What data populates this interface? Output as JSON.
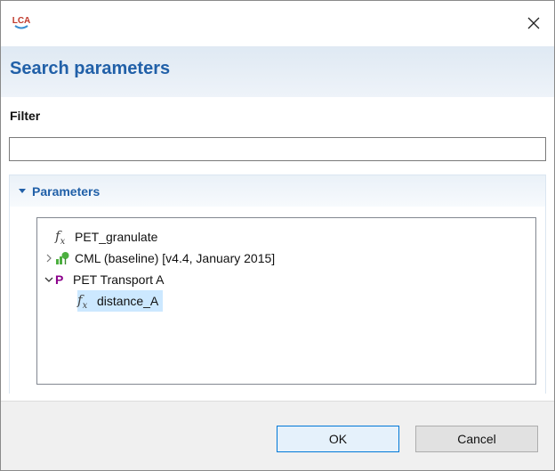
{
  "window": {
    "app_icon": "lca-logo-icon",
    "app_icon_text": "LCA",
    "close_icon": "close-icon"
  },
  "header": {
    "title": "Search parameters"
  },
  "filter": {
    "label": "Filter",
    "value": "",
    "placeholder": ""
  },
  "section": {
    "title": "Parameters",
    "toggle_icon": "chevron-down-icon",
    "tree": [
      {
        "label": "PET_granulate",
        "icon": "formula-icon",
        "level": 0,
        "expanded": null,
        "selected": false
      },
      {
        "label": "CML (baseline) [v4.4, January 2015]",
        "icon": "impact-method-icon",
        "level": 0,
        "expanded": false,
        "selected": false
      },
      {
        "label": "PET Transport A",
        "icon": "process-icon",
        "level": 0,
        "expanded": true,
        "selected": false
      },
      {
        "label": "distance_A",
        "icon": "formula-icon",
        "level": 1,
        "expanded": null,
        "selected": true
      }
    ]
  },
  "buttons": {
    "ok": "OK",
    "cancel": "Cancel"
  },
  "colors": {
    "header_title": "#2160a8",
    "process_tag": "#8b008b",
    "selection": "#cce8ff",
    "impact_icon": "#4caf3f"
  }
}
